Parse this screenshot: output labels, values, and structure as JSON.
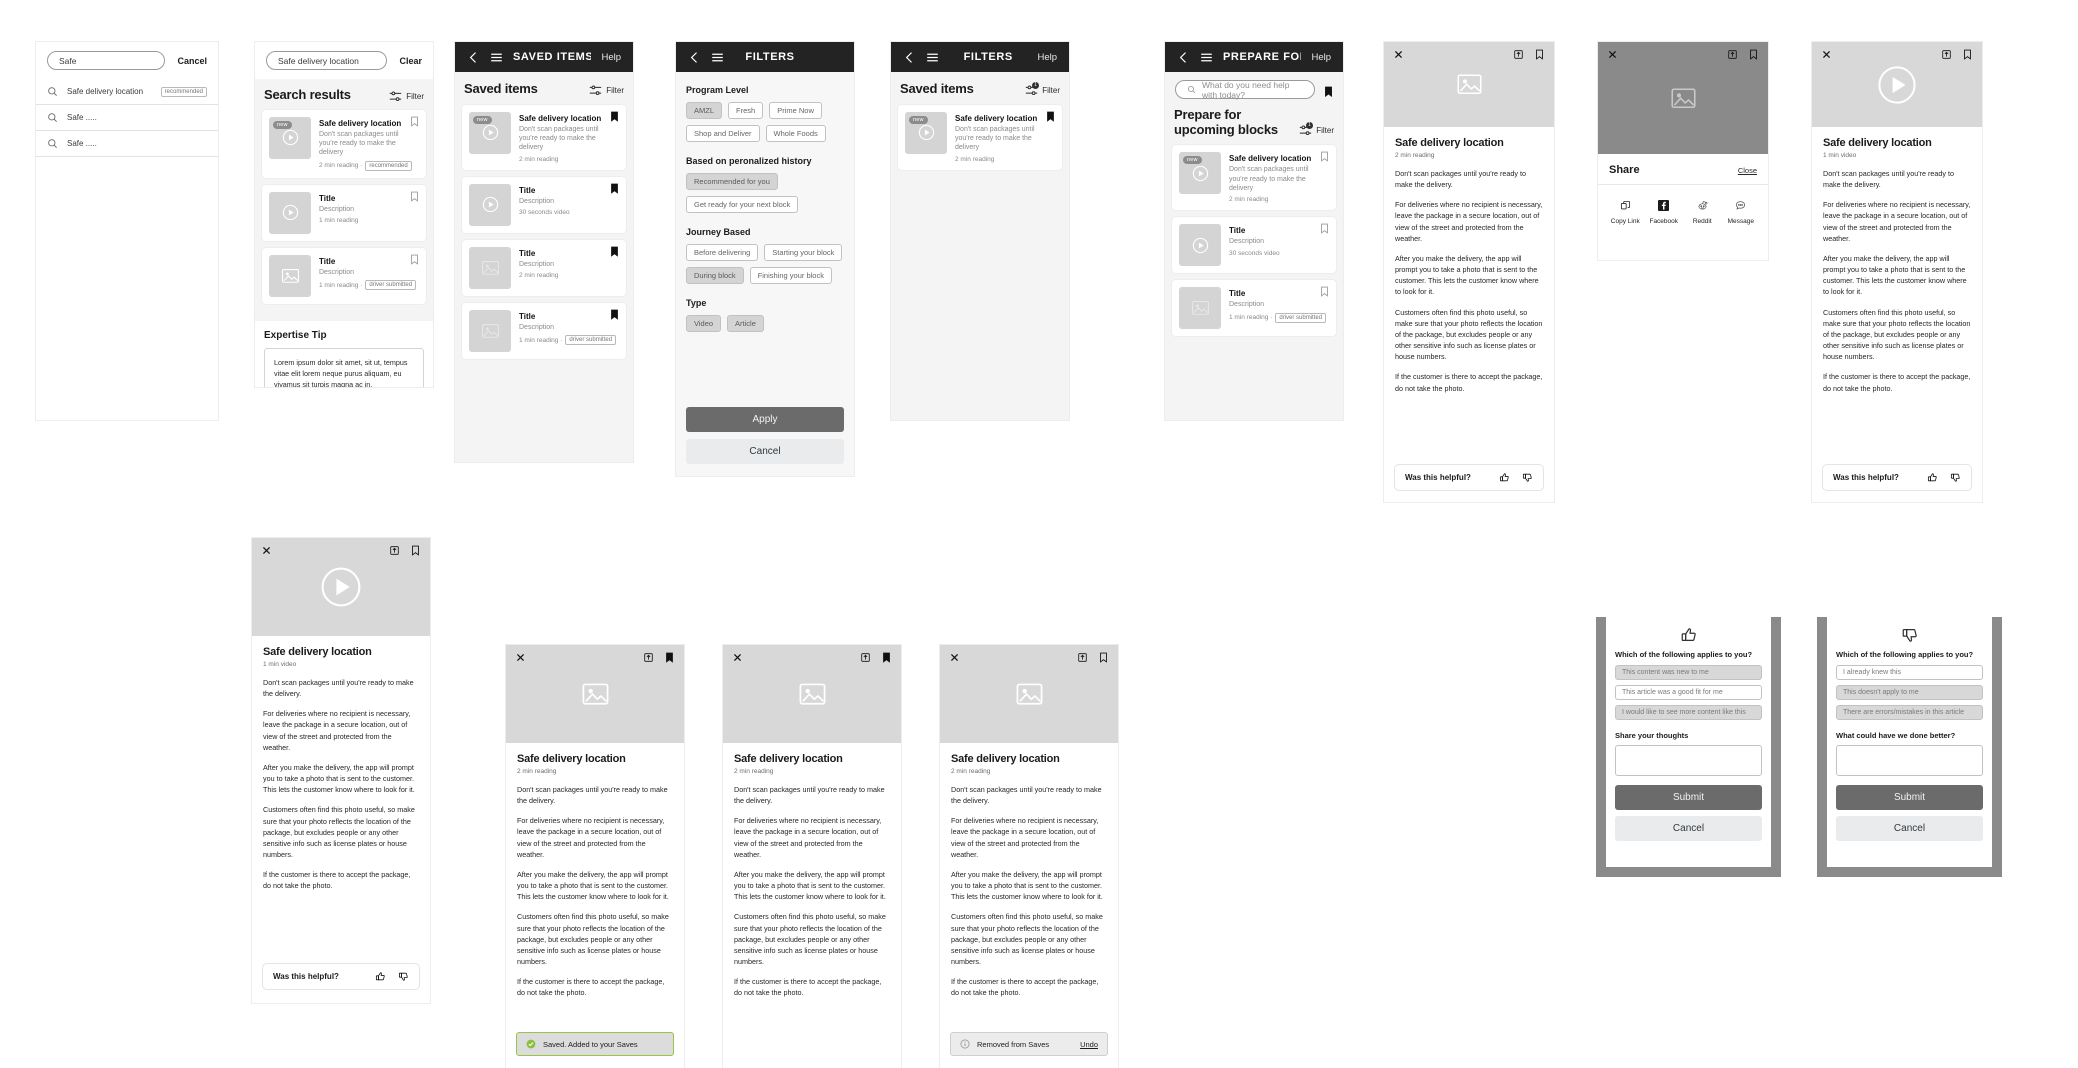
{
  "article": {
    "title": "Safe delivery location",
    "meta_video_1min": "1 min video",
    "meta_reading_1min": "1 min reading",
    "meta_reading_2min": "2 min reading",
    "paragraphs": [
      "Don't scan packages until you're ready to make the delivery.",
      "For deliveries where no recipient is necessary, leave the package in a secure location, out of view of the street and protected from the weather.",
      "After you make the delivery, the app will prompt you to take a photo that is sent to the customer. This lets the customer know where to look for it.",
      "Customers often find this photo useful, so make sure that your photo reflects the location of the package, but excludes people or any other sensitive info such as license plates or house numbers.",
      "If the customer is there to accept the package, do not take the photo."
    ],
    "helpful_label": "Was this helpful?"
  },
  "panel1_search": {
    "input_value": "Safe",
    "cancel_label": "Cancel",
    "suggestions": [
      {
        "label": "Safe delivery location",
        "tag": "recommended"
      },
      {
        "label": "Safe .....",
        "tag": ""
      },
      {
        "label": "Safe .....",
        "tag": ""
      }
    ]
  },
  "panel2_results": {
    "input_value": "Safe delivery location",
    "clear_label": "Clear",
    "heading": "Search results",
    "filter_label": "Filter",
    "cards": [
      {
        "badge": "new",
        "title": "Safe delivery location",
        "desc": "Don't scan packages until you're ready to make the delivery",
        "meta": "2 min reading ·",
        "chip": "recommended",
        "thumb": "play",
        "saved": false
      },
      {
        "badge": "",
        "title": "Title",
        "desc": "Description",
        "meta": "1 min reading",
        "chip": "",
        "thumb": "play",
        "saved": false
      },
      {
        "badge": "",
        "title": "Title",
        "desc": "Description",
        "meta": "1 min reading ·",
        "chip": "driver submitted",
        "thumb": "image",
        "saved": false
      }
    ],
    "tip_heading": "Expertise Tip",
    "tip_body": "Lorem ipsum dolor sit amet, sit ut, tempus vitae elit lorem neque purus aliquam, eu vivamus sit turpis magna ac in."
  },
  "panel3_saved": {
    "appbar_title": "SAVED ITEMS",
    "help_label": "Help",
    "heading": "Saved items",
    "filter_label": "Filter",
    "cards": [
      {
        "badge": "new",
        "title": "Safe delivery location",
        "desc": "Don't scan packages until you're ready to make the delivery",
        "meta": "2 min reading",
        "chip": "",
        "thumb": "play",
        "saved": true
      },
      {
        "badge": "",
        "title": "Title",
        "desc": "Description",
        "meta": "30 seconds video",
        "chip": "",
        "thumb": "play",
        "saved": true
      },
      {
        "badge": "",
        "title": "Title",
        "desc": "Description",
        "meta": "2 min reading",
        "chip": "",
        "thumb": "image",
        "saved": true
      },
      {
        "badge": "",
        "title": "Title",
        "desc": "Description",
        "meta": "1 min reading ·",
        "chip": "driver submitted",
        "thumb": "image",
        "saved": true
      }
    ]
  },
  "panel4_filters": {
    "appbar_title": "FILTERS",
    "groups": [
      {
        "heading": "Program Level",
        "chips": [
          {
            "label": "AMZL",
            "selected": true
          },
          {
            "label": "Fresh",
            "selected": false
          },
          {
            "label": "Prime Now",
            "selected": false
          },
          {
            "label": "Shop and Deliver",
            "selected": false
          },
          {
            "label": "Whole Foods",
            "selected": false
          }
        ]
      },
      {
        "heading": "Based on peronalized history",
        "chips": [
          {
            "label": "Recommended for you",
            "selected": true
          },
          {
            "label": "Get ready for your next block",
            "selected": false
          }
        ]
      },
      {
        "heading": "Journey Based",
        "chips": [
          {
            "label": "Before delivering",
            "selected": false
          },
          {
            "label": "Starting your block",
            "selected": false
          },
          {
            "label": "During block",
            "selected": true
          },
          {
            "label": "Finishing your block",
            "selected": false
          }
        ]
      },
      {
        "heading": "Type",
        "chips": [
          {
            "label": "Video",
            "selected": true
          },
          {
            "label": "Article",
            "selected": true
          }
        ]
      }
    ],
    "apply_label": "Apply",
    "cancel_label": "Cancel"
  },
  "panel5_filtered": {
    "appbar_title": "FILTERS",
    "help_label": "Help",
    "heading": "Saved items",
    "filter_label": "Filter",
    "filter_count": "1",
    "cards": [
      {
        "badge": "new",
        "title": "Safe delivery location",
        "desc": "Don't scan packages until you're ready to make the delivery",
        "meta": "2 min reading",
        "chip": "",
        "thumb": "play",
        "saved": true
      }
    ]
  },
  "panel6_prepare": {
    "appbar_title": "PREPARE FOR UP...",
    "help_label": "Help",
    "search_placeholder": "What do you need help with today?",
    "heading": "Prepare for upcoming blocks",
    "filter_label": "Filter",
    "filter_count": "1",
    "cards": [
      {
        "badge": "new",
        "title": "Safe delivery location",
        "desc": "Don't scan packages until you're ready to make the delivery",
        "meta": "2 min reading",
        "chip": "",
        "thumb": "play",
        "saved": false
      },
      {
        "badge": "",
        "title": "Title",
        "desc": "Description",
        "meta": "30 seconds video",
        "chip": "",
        "thumb": "play",
        "saved": false
      },
      {
        "badge": "",
        "title": "Title",
        "desc": "Description",
        "meta": "1 min reading ·",
        "chip": "driver submitted",
        "thumb": "image",
        "saved": false
      }
    ]
  },
  "share": {
    "heading": "Share",
    "close_label": "Close",
    "items": [
      {
        "label": "Copy Link",
        "icon": "copy-link-icon"
      },
      {
        "label": "Facebook",
        "icon": "facebook-icon"
      },
      {
        "label": "Reddit",
        "icon": "reddit-icon"
      },
      {
        "label": "Message",
        "icon": "message-icon"
      }
    ]
  },
  "toasts": {
    "saved": "Saved. Added to your Saves",
    "removed": "Removed from Saves",
    "undo": "Undo"
  },
  "feedback_up": {
    "glyph": "thumbs-up-icon",
    "question": "Which of the following applies to you?",
    "options": [
      {
        "label": "This content was new to me",
        "selected": true
      },
      {
        "label": "This article was a good fit for me",
        "selected": false
      },
      {
        "label": "I would like to see more content like this",
        "selected": true
      }
    ],
    "field_label": "Share your thoughts",
    "submit_label": "Submit",
    "cancel_label": "Cancel"
  },
  "feedback_down": {
    "glyph": "thumbs-down-icon",
    "question": "Which of the following applies to you?",
    "options": [
      {
        "label": "I already knew this",
        "selected": false
      },
      {
        "label": "This doesn't apply to me",
        "selected": true
      },
      {
        "label": "There are errors/mistakes in this article",
        "selected": true
      }
    ],
    "field_label": "What could have we done better?",
    "submit_label": "Submit",
    "cancel_label": "Cancel"
  }
}
